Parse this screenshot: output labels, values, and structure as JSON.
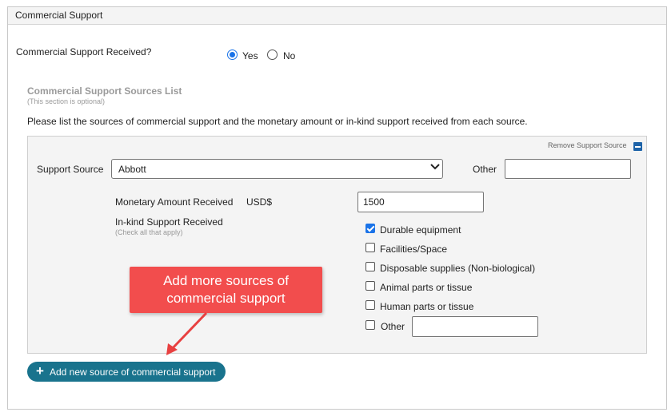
{
  "panel": {
    "title": "Commercial Support"
  },
  "question": {
    "label": "Commercial Support Received?",
    "options": [
      {
        "label": "Yes",
        "selected": true
      },
      {
        "label": "No",
        "selected": false
      }
    ]
  },
  "sources_section": {
    "title": "Commercial Support Sources List",
    "subtitle": "(This section is optional)",
    "instructions": "Please list the sources of commercial support and the monetary amount or in-kind support received from each source."
  },
  "source_entry": {
    "remove_label": "Remove Support Source",
    "source_label": "Support Source",
    "source_value": "Abbott",
    "other_label": "Other",
    "other_value": "",
    "monetary_label": "Monetary Amount Received",
    "currency_label": "USD$",
    "monetary_value": "1500",
    "inkind_label": "In-kind Support Received",
    "inkind_hint": "(Check all that apply)",
    "inkind_options": [
      {
        "label": "Durable equipment",
        "checked": true
      },
      {
        "label": "Facilities/Space",
        "checked": false
      },
      {
        "label": "Disposable supplies (Non-biological)",
        "checked": false
      },
      {
        "label": "Animal parts or tissue",
        "checked": false
      },
      {
        "label": "Human parts or tissue",
        "checked": false
      },
      {
        "label": "Other",
        "checked": false
      }
    ],
    "inkind_other_value": ""
  },
  "callout": {
    "line1": "Add more sources of",
    "line2": "commercial support"
  },
  "add_button": {
    "label": "Add new source of commercial support"
  },
  "colors": {
    "accent": "#1a73e8",
    "button": "#19738d",
    "callout": "#f24d4d",
    "arrow": "#e84040"
  }
}
